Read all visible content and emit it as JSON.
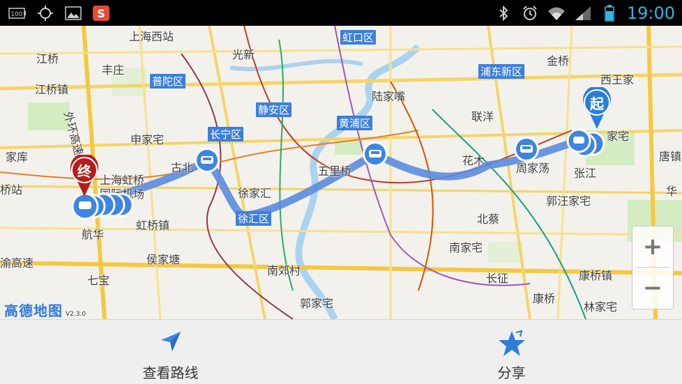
{
  "status_bar": {
    "battery_level_badge": "100",
    "time": "19:00",
    "icons": [
      "battery-level-icon",
      "location-target-icon",
      "gallery-icon",
      "sogou-input-icon",
      "bluetooth-icon",
      "alarm-icon",
      "wifi-icon",
      "signal-icon",
      "battery-icon"
    ]
  },
  "map": {
    "place_labels": [
      "上海西站",
      "光新",
      "虹口区",
      "江桥",
      "丰庄",
      "江桥镇",
      "普陀区",
      "陆家嘴",
      "浦东新区",
      "金桥",
      "西王家",
      "静安区",
      "黄浦区",
      "联洋",
      "长宁区",
      "古北",
      "申家宅",
      "五里桥",
      "花木",
      "周家荡",
      "张江",
      "唐镇",
      "家宅",
      "上海虹桥",
      "国际机场",
      "徐家汇",
      "徐汇区",
      "虹桥镇",
      "郭汪家宅",
      "北蔡",
      "航华",
      "侯家塘",
      "南家宅",
      "南郊村",
      "长征",
      "康桥镇",
      "七宝",
      "郭家宅",
      "康桥",
      "林家宅",
      "家库",
      "桥站",
      "外环高速",
      "渝高速",
      "华",
      "金桥"
    ],
    "district_labels": [
      "虹口区",
      "普陀区",
      "浦东新区",
      "静安区",
      "黄浦区",
      "长宁区",
      "徐汇区"
    ],
    "start_marker": "起",
    "end_marker": "终",
    "watermark": "高德地图",
    "version": "V2.3.0",
    "zoom_in": "+",
    "zoom_out": "−",
    "route_color": "#5b8be0"
  },
  "bottom_bar": {
    "view_route_label": "查看路线",
    "share_label": "分享"
  }
}
